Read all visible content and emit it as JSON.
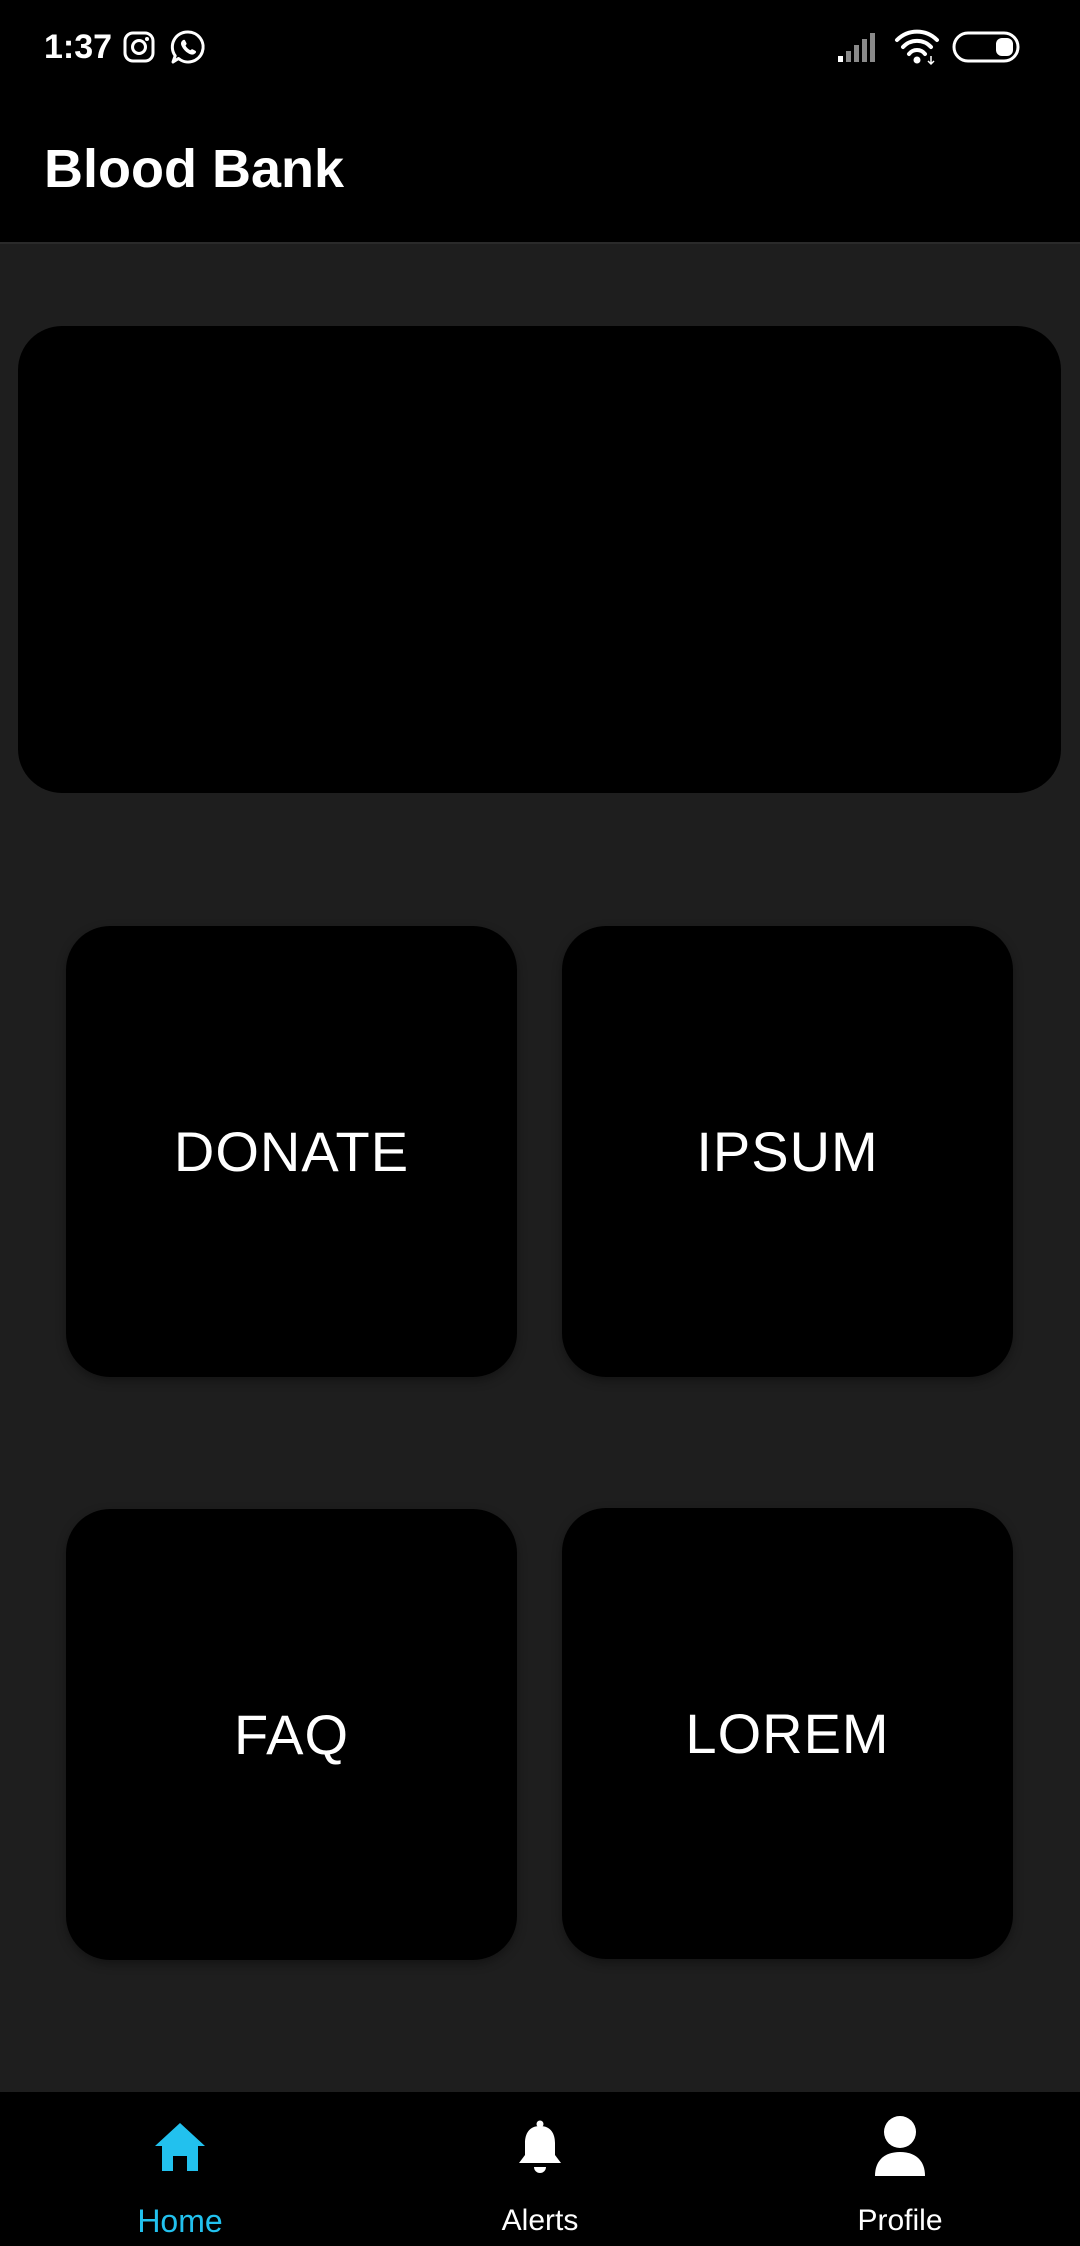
{
  "status_bar": {
    "time": "1:37",
    "left_icons": [
      "instagram-icon",
      "whatsapp-icon"
    ],
    "right_icons": [
      "cell-signal-icon",
      "wifi-icon",
      "battery-icon"
    ]
  },
  "app_bar": {
    "title": "Blood Bank"
  },
  "tiles": [
    {
      "label": "DONATE"
    },
    {
      "label": "IPSUM"
    },
    {
      "label": "FAQ"
    },
    {
      "label": "LOREM"
    }
  ],
  "bottom_nav": {
    "items": [
      {
        "label": "Home",
        "icon": "home-icon",
        "active": true
      },
      {
        "label": "Alerts",
        "icon": "bell-icon",
        "active": false
      },
      {
        "label": "Profile",
        "icon": "person-icon",
        "active": false
      }
    ]
  },
  "colors": {
    "background": "#1e1e1e",
    "surface": "#000000",
    "accent": "#22c1ee",
    "text": "#ffffff"
  }
}
